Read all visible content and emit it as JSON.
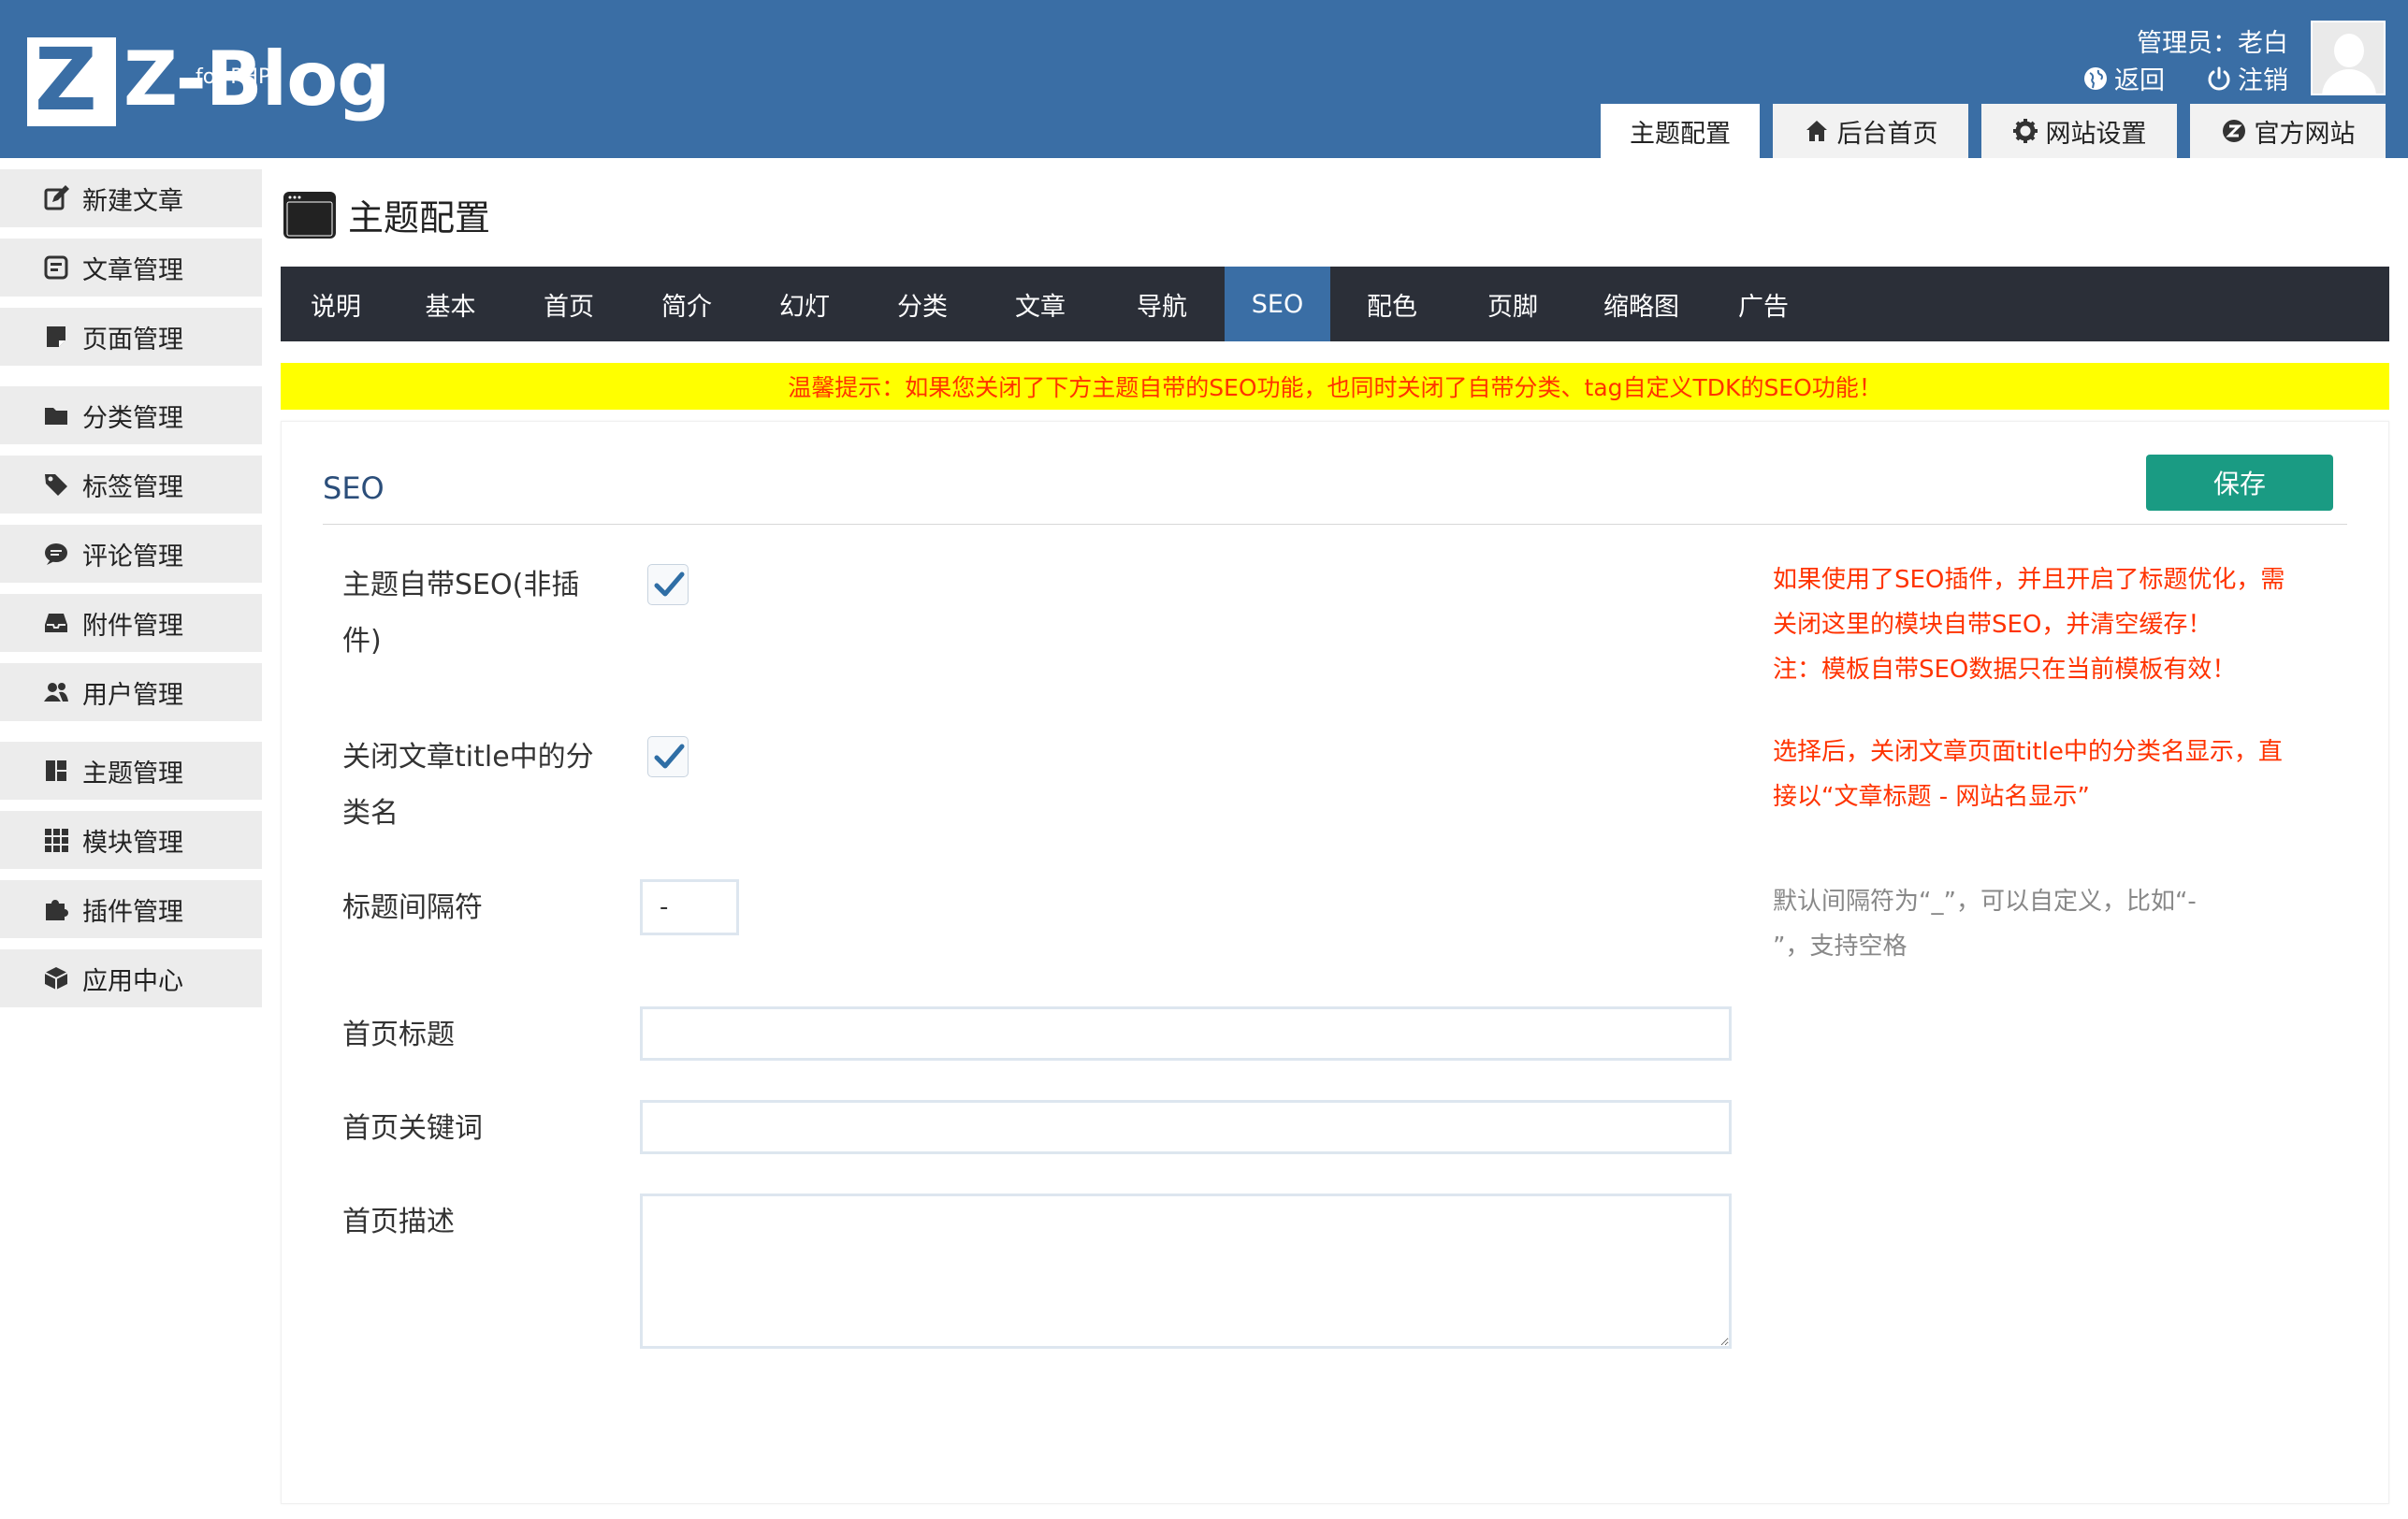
{
  "header": {
    "logo_text": "Z-Blog",
    "logo_letter": "Z",
    "logo_sub": "for PHP",
    "admin_label": "管理员：老白",
    "links": {
      "back": "返回",
      "logout": "注销"
    },
    "tabs": [
      {
        "label": "主题配置",
        "icon": ""
      },
      {
        "label": "后台首页",
        "icon": "home-icon"
      },
      {
        "label": "网站设置",
        "icon": "gear-icon"
      },
      {
        "label": "官方网站",
        "icon": "zblog-icon"
      }
    ]
  },
  "sidebar": {
    "items": [
      {
        "label": "新建文章",
        "icon": "edit-icon"
      },
      {
        "label": "文章管理",
        "icon": "article-icon"
      },
      {
        "label": "页面管理",
        "icon": "page-icon"
      },
      {
        "label": "分类管理",
        "icon": "folder-icon"
      },
      {
        "label": "标签管理",
        "icon": "tag-icon"
      },
      {
        "label": "评论管理",
        "icon": "comment-icon"
      },
      {
        "label": "附件管理",
        "icon": "inbox-icon"
      },
      {
        "label": "用户管理",
        "icon": "users-icon"
      },
      {
        "label": "主题管理",
        "icon": "layout-icon"
      },
      {
        "label": "模块管理",
        "icon": "grid-icon"
      },
      {
        "label": "插件管理",
        "icon": "puzzle-icon"
      },
      {
        "label": "应用中心",
        "icon": "box-icon"
      }
    ]
  },
  "page": {
    "title": "主题配置"
  },
  "theme_tabs": [
    "说明",
    "基本",
    "首页",
    "简介",
    "幻灯",
    "分类",
    "文章",
    "导航",
    "SEO",
    "配色",
    "页脚",
    "缩略图",
    "广告"
  ],
  "active_tab": "SEO",
  "notice": "温馨提示：如果您关闭了下方主题自带的SEO功能，也同时关闭了自带分类、tag自定义TDK的SEO功能！",
  "panel": {
    "title": "SEO",
    "save_label": "保存",
    "fields": {
      "theme_seo": {
        "label_line1": "主题自带SEO(非插",
        "label_line2": "件)",
        "checked": true,
        "hint_lines": [
          "如果使用了SEO插件，并且开启了标题优化，需",
          "关闭这里的模块自带SEO，并清空缓存！",
          "注：模板自带SEO数据只在当前模板有效！"
        ]
      },
      "hide_category": {
        "label_line1": "关闭文章title中的分",
        "label_line2": "类名",
        "checked": true,
        "hint_lines": [
          "选择后，关闭文章页面title中的分类名显示，直",
          "接以“文章标题 - 网站名显示”"
        ]
      },
      "separator": {
        "label": "标题间隔符",
        "value": "-",
        "hint_lines": [
          "默认间隔符为“_”，可以自定义，比如“-",
          "”，支持空格"
        ]
      },
      "home_title": {
        "label": "首页标题",
        "value": ""
      },
      "home_keywords": {
        "label": "首页关键词",
        "value": ""
      },
      "home_description": {
        "label": "首页描述",
        "value": ""
      }
    }
  },
  "colors": {
    "header_bg": "#3a6ea5",
    "tabbar_bg": "#2b2f38",
    "active_tab_bg": "#3a6ea5",
    "notice_bg": "#ffff00",
    "notice_text": "#ff3300",
    "save_button": "#1a9b83"
  }
}
